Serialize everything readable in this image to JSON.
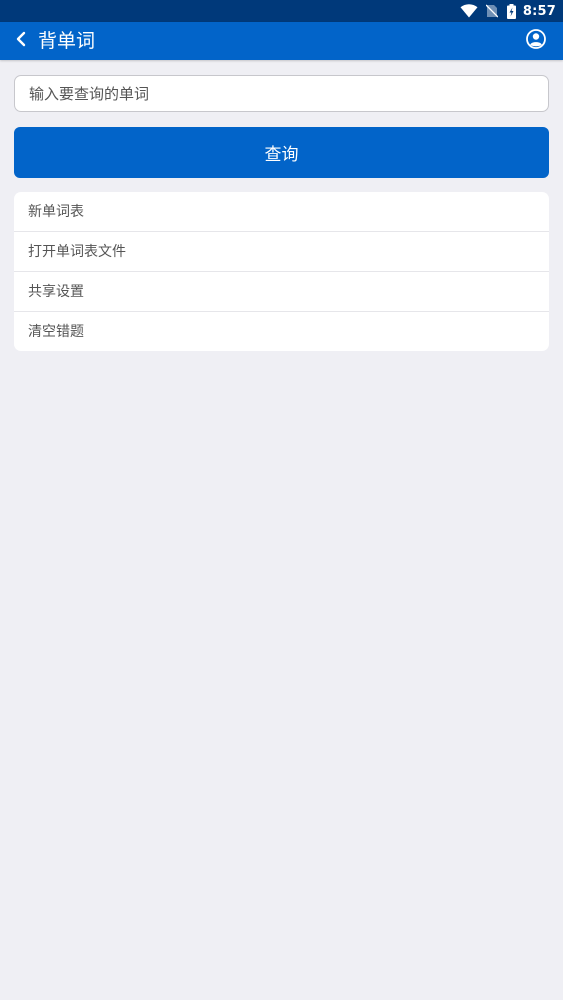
{
  "status_bar": {
    "time": "8:57",
    "icons": [
      "wifi-icon",
      "no-sim-icon",
      "battery-charging-icon"
    ]
  },
  "app_bar": {
    "back_icon": "chevron-left-icon",
    "title": "背单词",
    "user_icon": "user-circle-icon"
  },
  "search": {
    "placeholder": "输入要查询的单词",
    "value": "",
    "button_label": "查询"
  },
  "menu": {
    "items": [
      {
        "label": "新单词表"
      },
      {
        "label": "打开单词表文件"
      },
      {
        "label": "共享设置"
      },
      {
        "label": "清空错题"
      }
    ]
  },
  "colors": {
    "status_bar": "#00397a",
    "app_bar": "#0264c9",
    "accent": "#0264c9",
    "background": "#efeff4"
  }
}
